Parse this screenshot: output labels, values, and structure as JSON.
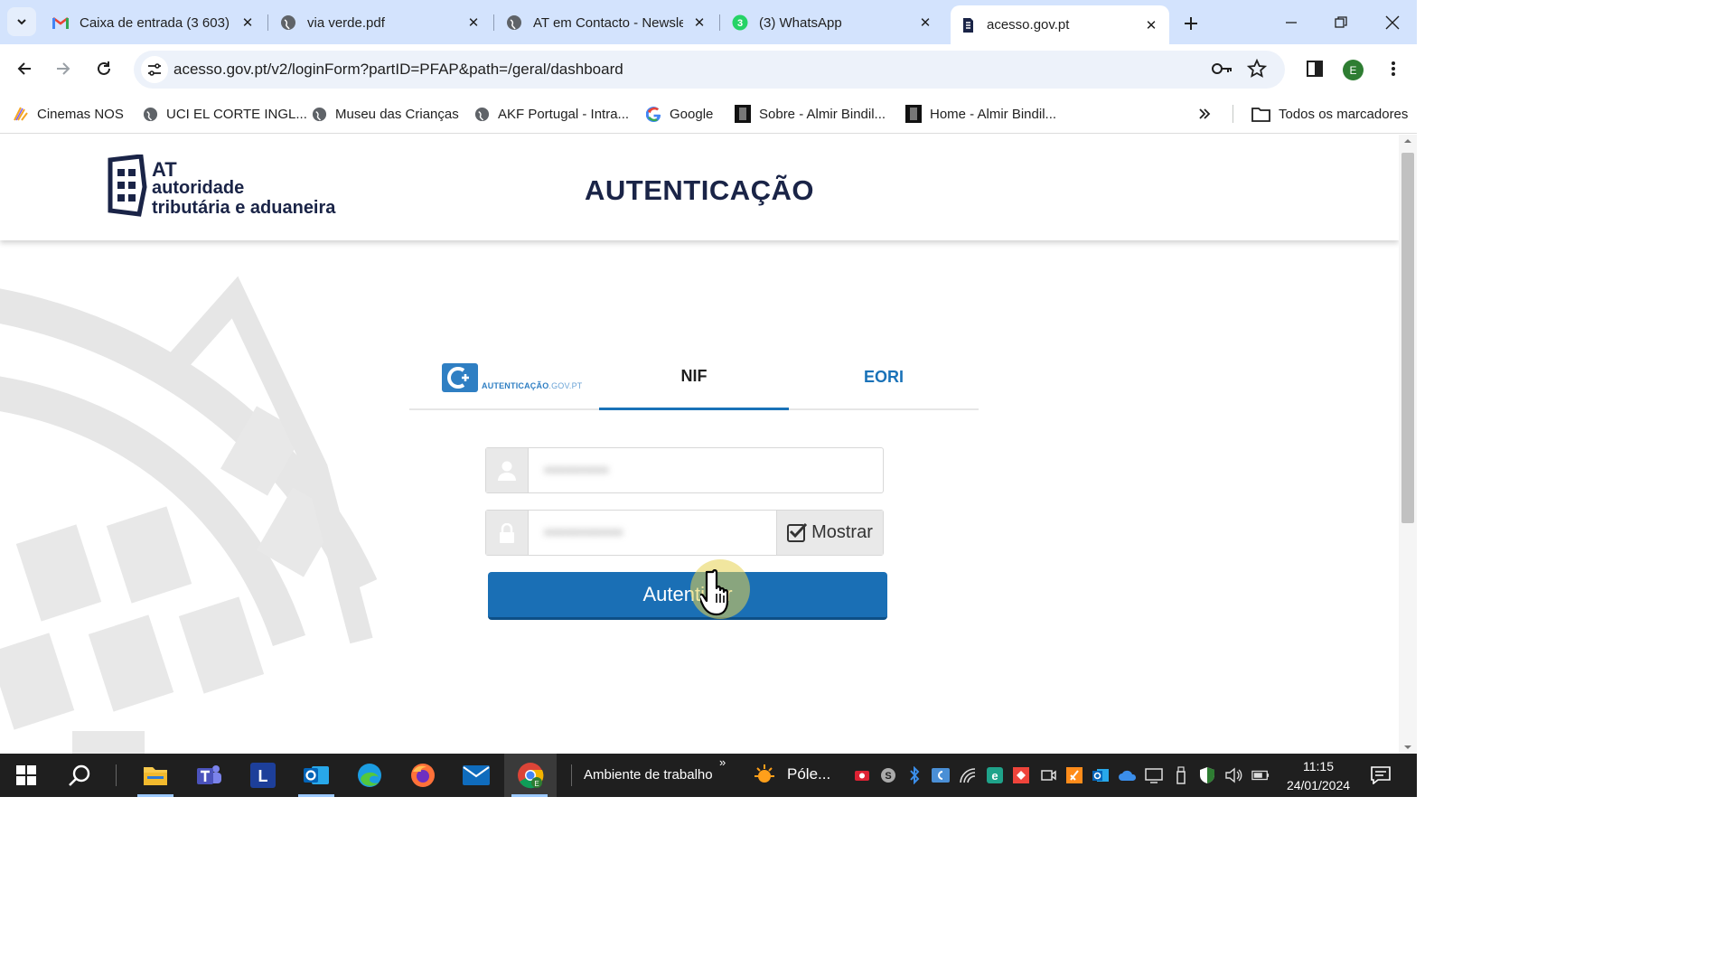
{
  "browser": {
    "tabs": [
      {
        "title": "Caixa de entrada (3 603)",
        "icon": "gmail-icon"
      },
      {
        "title": "via verde.pdf",
        "icon": "globe-icon"
      },
      {
        "title": "AT em Contacto - Newsle",
        "icon": "globe-icon"
      },
      {
        "title": "(3) WhatsApp",
        "icon": "whatsapp-icon",
        "badge": "3"
      },
      {
        "title": "acesso.gov.pt",
        "icon": "at-favicon",
        "active": true
      }
    ],
    "url": "acesso.gov.pt/v2/loginForm?partID=PFAP&path=/geral/dashboard",
    "profile_initial": "E",
    "bookmarks": [
      {
        "label": "Cinemas NOS",
        "icon": "nos-icon"
      },
      {
        "label": "UCI EL CORTE INGL...",
        "icon": "globe-icon"
      },
      {
        "label": "Museu das Crianças",
        "icon": "globe-icon"
      },
      {
        "label": "AKF Portugal - Intra...",
        "icon": "globe-icon"
      },
      {
        "label": "Google",
        "icon": "google-icon"
      },
      {
        "label": "Sobre - Almir Bindil...",
        "icon": "site-icon"
      },
      {
        "label": "Home - Almir Bindil...",
        "icon": "site-icon"
      }
    ],
    "all_bookmarks": "Todos os marcadores"
  },
  "page": {
    "logo": {
      "line1": "AT",
      "line2": "autoridade",
      "line3": "tributária e aduaneira"
    },
    "title": "AUTENTICAÇÃO",
    "login_tabs": {
      "gov_label_bold": "AUTENTICAÇÃO",
      "gov_label_rest": ".GOV.PT",
      "nif": "NIF",
      "eori": "EORI"
    },
    "username_value": "•••••••••",
    "password_value": "•••••••••••",
    "show_label": "Mostrar",
    "submit_label": "Autenticar"
  },
  "taskbar": {
    "desktop_label": "Ambiente de trabalho",
    "weather_label": "Póle...",
    "time": "11:15",
    "date": "24/01/2024"
  },
  "colors": {
    "tabstrip": "#d3e3fd",
    "primary_button": "#1a6fb5",
    "title": "#1a2447",
    "eori_link": "#1a72b8"
  }
}
